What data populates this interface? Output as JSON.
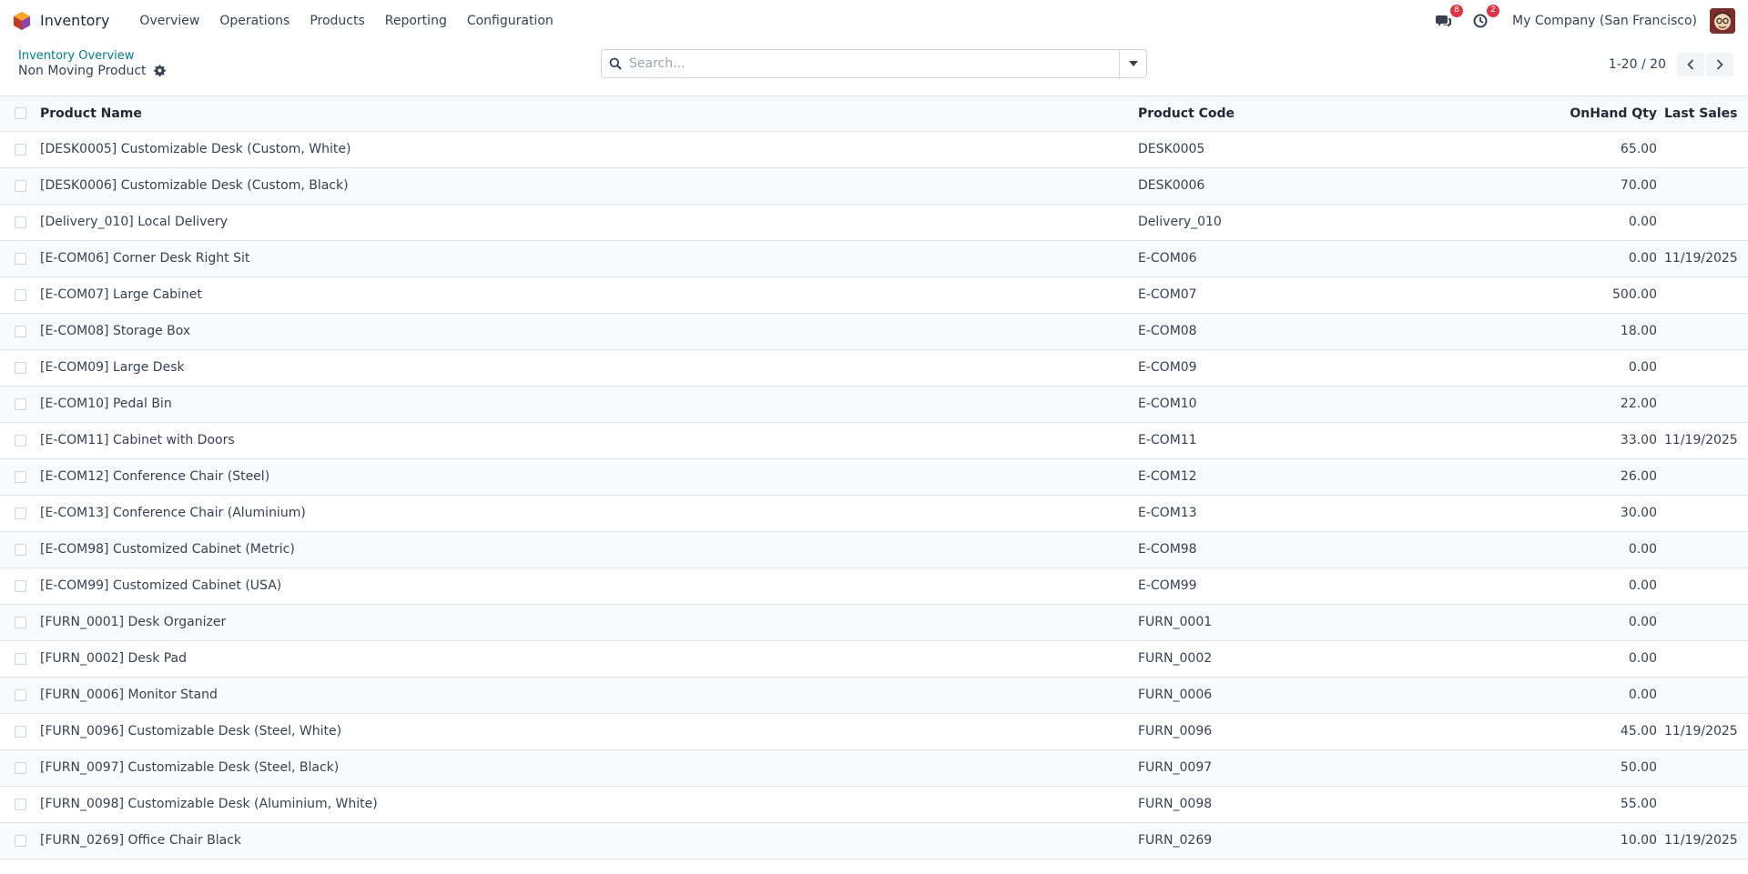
{
  "navbar": {
    "app_name": "Inventory",
    "menu": [
      "Overview",
      "Operations",
      "Products",
      "Reporting",
      "Configuration"
    ],
    "messages_count": "8",
    "activities_count": "2",
    "company": "My Company (San Francisco)"
  },
  "control_panel": {
    "breadcrumb_parent": "Inventory Overview",
    "breadcrumb_current": "Non Moving Product",
    "search_placeholder": "Search...",
    "pager": "1-20 / 20"
  },
  "table": {
    "headers": {
      "name": "Product Name",
      "code": "Product Code",
      "qty": "OnHand Qty",
      "sales": "Last Sales"
    },
    "rows": [
      {
        "name": "[DESK0005] Customizable Desk (Custom, White)",
        "code": "DESK0005",
        "qty": "65.00",
        "sales": ""
      },
      {
        "name": "[DESK0006] Customizable Desk (Custom, Black)",
        "code": "DESK0006",
        "qty": "70.00",
        "sales": ""
      },
      {
        "name": "[Delivery_010] Local Delivery",
        "code": "Delivery_010",
        "qty": "0.00",
        "sales": ""
      },
      {
        "name": "[E-COM06] Corner Desk Right Sit",
        "code": "E-COM06",
        "qty": "0.00",
        "sales": "11/19/2025"
      },
      {
        "name": "[E-COM07] Large Cabinet",
        "code": "E-COM07",
        "qty": "500.00",
        "sales": ""
      },
      {
        "name": "[E-COM08] Storage Box",
        "code": "E-COM08",
        "qty": "18.00",
        "sales": ""
      },
      {
        "name": "[E-COM09] Large Desk",
        "code": "E-COM09",
        "qty": "0.00",
        "sales": ""
      },
      {
        "name": "[E-COM10] Pedal Bin",
        "code": "E-COM10",
        "qty": "22.00",
        "sales": ""
      },
      {
        "name": "[E-COM11] Cabinet with Doors",
        "code": "E-COM11",
        "qty": "33.00",
        "sales": "11/19/2025"
      },
      {
        "name": "[E-COM12] Conference Chair (Steel)",
        "code": "E-COM12",
        "qty": "26.00",
        "sales": ""
      },
      {
        "name": "[E-COM13] Conference Chair (Aluminium)",
        "code": "E-COM13",
        "qty": "30.00",
        "sales": ""
      },
      {
        "name": "[E-COM98] Customized Cabinet (Metric)",
        "code": "E-COM98",
        "qty": "0.00",
        "sales": ""
      },
      {
        "name": "[E-COM99] Customized Cabinet (USA)",
        "code": "E-COM99",
        "qty": "0.00",
        "sales": ""
      },
      {
        "name": "[FURN_0001] Desk Organizer",
        "code": "FURN_0001",
        "qty": "0.00",
        "sales": ""
      },
      {
        "name": "[FURN_0002] Desk Pad",
        "code": "FURN_0002",
        "qty": "0.00",
        "sales": ""
      },
      {
        "name": "[FURN_0006] Monitor Stand",
        "code": "FURN_0006",
        "qty": "0.00",
        "sales": ""
      },
      {
        "name": "[FURN_0096] Customizable Desk (Steel, White)",
        "code": "FURN_0096",
        "qty": "45.00",
        "sales": "11/19/2025"
      },
      {
        "name": "[FURN_0097] Customizable Desk (Steel, Black)",
        "code": "FURN_0097",
        "qty": "50.00",
        "sales": ""
      },
      {
        "name": "[FURN_0098] Customizable Desk (Aluminium, White)",
        "code": "FURN_0098",
        "qty": "55.00",
        "sales": ""
      },
      {
        "name": "[FURN_0269] Office Chair Black",
        "code": "FURN_0269",
        "qty": "10.00",
        "sales": "11/19/2025"
      }
    ]
  },
  "colors": {
    "link": "#017e84",
    "badge": "#dc3545"
  },
  "icons": [
    "odoo-app-icon",
    "chat-icon",
    "clock-icon",
    "gear-icon",
    "search-icon",
    "caret-down-icon",
    "chevron-left-icon",
    "chevron-right-icon"
  ]
}
